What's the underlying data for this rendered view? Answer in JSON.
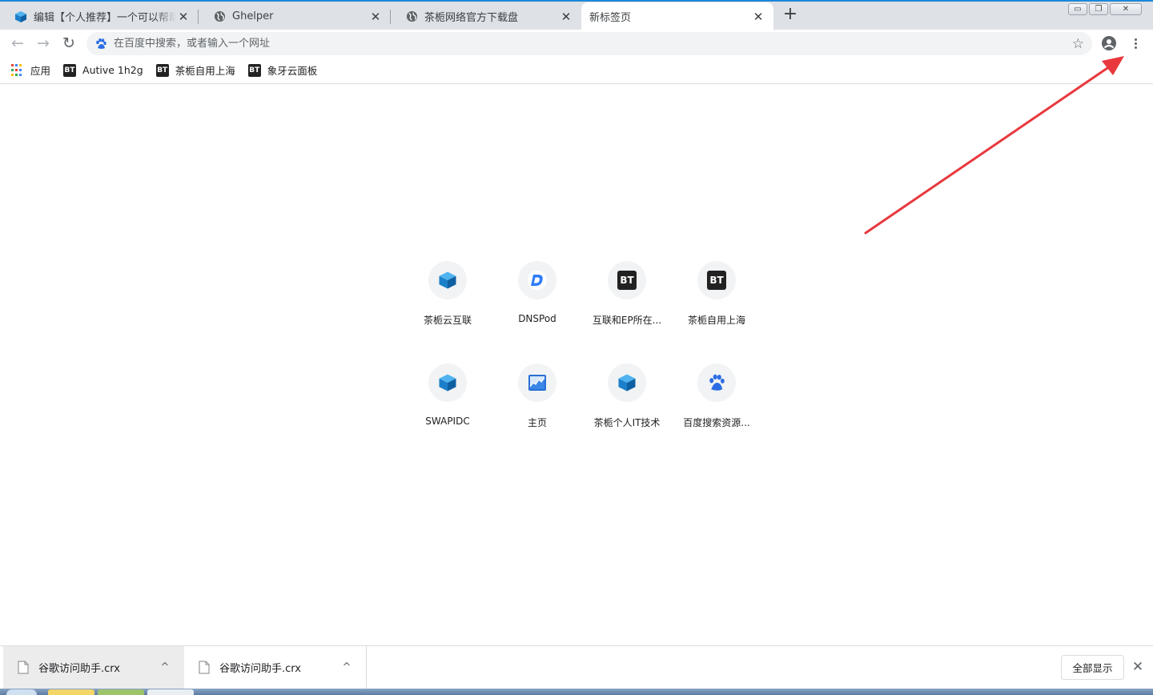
{
  "tabs": [
    {
      "title": "编辑【个人推荐】一个可以帮助你",
      "favicon": "cube-icon"
    },
    {
      "title": "Ghelper",
      "favicon": "globe-icon"
    },
    {
      "title": "茶栀网络官方下载盘",
      "favicon": "globe-icon"
    },
    {
      "title": "新标签页",
      "favicon": "none",
      "active": true
    }
  ],
  "new_tab_label": "+",
  "window_controls": {
    "minimize": "▭",
    "restore": "❐",
    "close": "✕"
  },
  "toolbar": {
    "back_icon": "←",
    "forward_icon": "→",
    "reload_icon": "↻",
    "omnibox_placeholder": "在百度中搜索，或者输入一个网址",
    "bookmark_star_icon": "☆"
  },
  "bookmarks": [
    {
      "label": "应用",
      "icon": "apps-grid-icon"
    },
    {
      "label": "Autive 1h2g",
      "icon": "bt-icon"
    },
    {
      "label": "茶栀自用上海",
      "icon": "bt-icon"
    },
    {
      "label": "象牙云面板",
      "icon": "bt-icon"
    }
  ],
  "bt_text": "BT",
  "shortcuts": [
    {
      "label": "茶栀云互联",
      "icon": "cube-icon"
    },
    {
      "label": "DNSPod",
      "icon": "dnspod-icon"
    },
    {
      "label": "互联和EP所在...",
      "icon": "bt-icon"
    },
    {
      "label": "茶栀自用上海",
      "icon": "bt-icon"
    },
    {
      "label": "SWAPIDC",
      "icon": "cube-icon"
    },
    {
      "label": "主页",
      "icon": "chart-icon"
    },
    {
      "label": "茶栀个人IT技术",
      "icon": "cube-icon"
    },
    {
      "label": "百度搜索资源...",
      "icon": "baidu-paw-icon"
    }
  ],
  "downloads": [
    {
      "filename": "谷歌访问助手.crx",
      "chevron": "^"
    },
    {
      "filename": "谷歌访问助手.crx",
      "chevron": "^"
    }
  ],
  "shelf": {
    "show_all_label": "全部显示",
    "close_icon": "✕"
  },
  "colors": {
    "accent_blue": "#1e88d8",
    "arrow_red": "#e8383d",
    "tab_strip": "#dee1e6"
  }
}
